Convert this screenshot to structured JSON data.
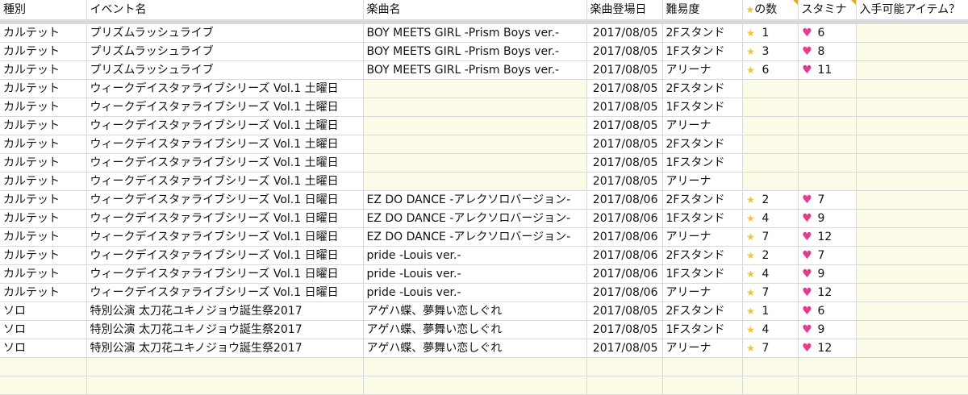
{
  "headers": {
    "type": "種別",
    "event": "イベント名",
    "song": "楽曲名",
    "date": "楽曲登場日",
    "difficulty": "難易度",
    "stars": "の数",
    "stamina": "スタミナ",
    "item": "入手可能アイテム？"
  },
  "icons": {
    "star": "star-icon",
    "heart": "heart-icon"
  },
  "colors": {
    "header_bar": "#d7d9dc",
    "empty_cell": "#fcfbe8",
    "comment_flag": "#e3a92e",
    "heart": "#e33c8e",
    "star": "#f0c23b"
  },
  "rows": [
    {
      "type": "カルテット",
      "event": "プリズムラッシュライブ",
      "song": "BOY MEETS GIRL -Prism Boys ver.-",
      "date": "2017/08/05",
      "difficulty": "2Fスタンド",
      "stars": "1",
      "stamina": "6"
    },
    {
      "type": "カルテット",
      "event": "プリズムラッシュライブ",
      "song": "BOY MEETS GIRL -Prism Boys ver.-",
      "date": "2017/08/05",
      "difficulty": "1Fスタンド",
      "stars": "3",
      "stamina": "8"
    },
    {
      "type": "カルテット",
      "event": "プリズムラッシュライブ",
      "song": "BOY MEETS GIRL -Prism Boys ver.-",
      "date": "2017/08/05",
      "difficulty": "アリーナ",
      "stars": "6",
      "stamina": "11"
    },
    {
      "type": "カルテット",
      "event": "ウィークデイスタァライブシリーズ Vol.1 土曜日",
      "song": "",
      "date": "2017/08/05",
      "difficulty": "2Fスタンド",
      "stars": "",
      "stamina": ""
    },
    {
      "type": "カルテット",
      "event": "ウィークデイスタァライブシリーズ Vol.1 土曜日",
      "song": "",
      "date": "2017/08/05",
      "difficulty": "1Fスタンド",
      "stars": "",
      "stamina": ""
    },
    {
      "type": "カルテット",
      "event": "ウィークデイスタァライブシリーズ Vol.1 土曜日",
      "song": "",
      "date": "2017/08/05",
      "difficulty": "アリーナ",
      "stars": "",
      "stamina": ""
    },
    {
      "type": "カルテット",
      "event": "ウィークデイスタァライブシリーズ Vol.1 土曜日",
      "song": "",
      "date": "2017/08/05",
      "difficulty": "2Fスタンド",
      "stars": "",
      "stamina": ""
    },
    {
      "type": "カルテット",
      "event": "ウィークデイスタァライブシリーズ Vol.1 土曜日",
      "song": "",
      "date": "2017/08/05",
      "difficulty": "1Fスタンド",
      "stars": "",
      "stamina": ""
    },
    {
      "type": "カルテット",
      "event": "ウィークデイスタァライブシリーズ Vol.1 土曜日",
      "song": "",
      "date": "2017/08/05",
      "difficulty": "アリーナ",
      "stars": "",
      "stamina": ""
    },
    {
      "type": "カルテット",
      "event": "ウィークデイスタァライブシリーズ Vol.1 日曜日",
      "song": "EZ DO DANCE -アレクソロバージョン-",
      "date": "2017/08/06",
      "difficulty": "2Fスタンド",
      "stars": "2",
      "stamina": "7"
    },
    {
      "type": "カルテット",
      "event": "ウィークデイスタァライブシリーズ Vol.1 日曜日",
      "song": "EZ DO DANCE -アレクソロバージョン-",
      "date": "2017/08/06",
      "difficulty": "1Fスタンド",
      "stars": "4",
      "stamina": "9"
    },
    {
      "type": "カルテット",
      "event": "ウィークデイスタァライブシリーズ Vol.1 日曜日",
      "song": "EZ DO DANCE -アレクソロバージョン-",
      "date": "2017/08/06",
      "difficulty": "アリーナ",
      "stars": "7",
      "stamina": "12"
    },
    {
      "type": "カルテット",
      "event": "ウィークデイスタァライブシリーズ Vol.1 日曜日",
      "song": "pride -Louis ver.-",
      "date": "2017/08/06",
      "difficulty": "2Fスタンド",
      "stars": "2",
      "stamina": "7"
    },
    {
      "type": "カルテット",
      "event": "ウィークデイスタァライブシリーズ Vol.1 日曜日",
      "song": "pride -Louis ver.-",
      "date": "2017/08/06",
      "difficulty": "1Fスタンド",
      "stars": "4",
      "stamina": "9"
    },
    {
      "type": "カルテット",
      "event": "ウィークデイスタァライブシリーズ Vol.1 日曜日",
      "song": "pride -Louis ver.-",
      "date": "2017/08/06",
      "difficulty": "アリーナ",
      "stars": "7",
      "stamina": "12"
    },
    {
      "type": "ソロ",
      "event": "特別公演 太刀花ユキノジョウ誕生祭2017",
      "song": "アゲハ蝶、夢舞い恋しぐれ",
      "date": "2017/08/05",
      "difficulty": "2Fスタンド",
      "stars": "1",
      "stamina": "6"
    },
    {
      "type": "ソロ",
      "event": "特別公演 太刀花ユキノジョウ誕生祭2017",
      "song": "アゲハ蝶、夢舞い恋しぐれ",
      "date": "2017/08/05",
      "difficulty": "1Fスタンド",
      "stars": "4",
      "stamina": "9"
    },
    {
      "type": "ソロ",
      "event": "特別公演 太刀花ユキノジョウ誕生祭2017",
      "song": "アゲハ蝶、夢舞い恋しぐれ",
      "date": "2017/08/05",
      "difficulty": "アリーナ",
      "stars": "7",
      "stamina": "12"
    }
  ],
  "empty_rows": 2
}
